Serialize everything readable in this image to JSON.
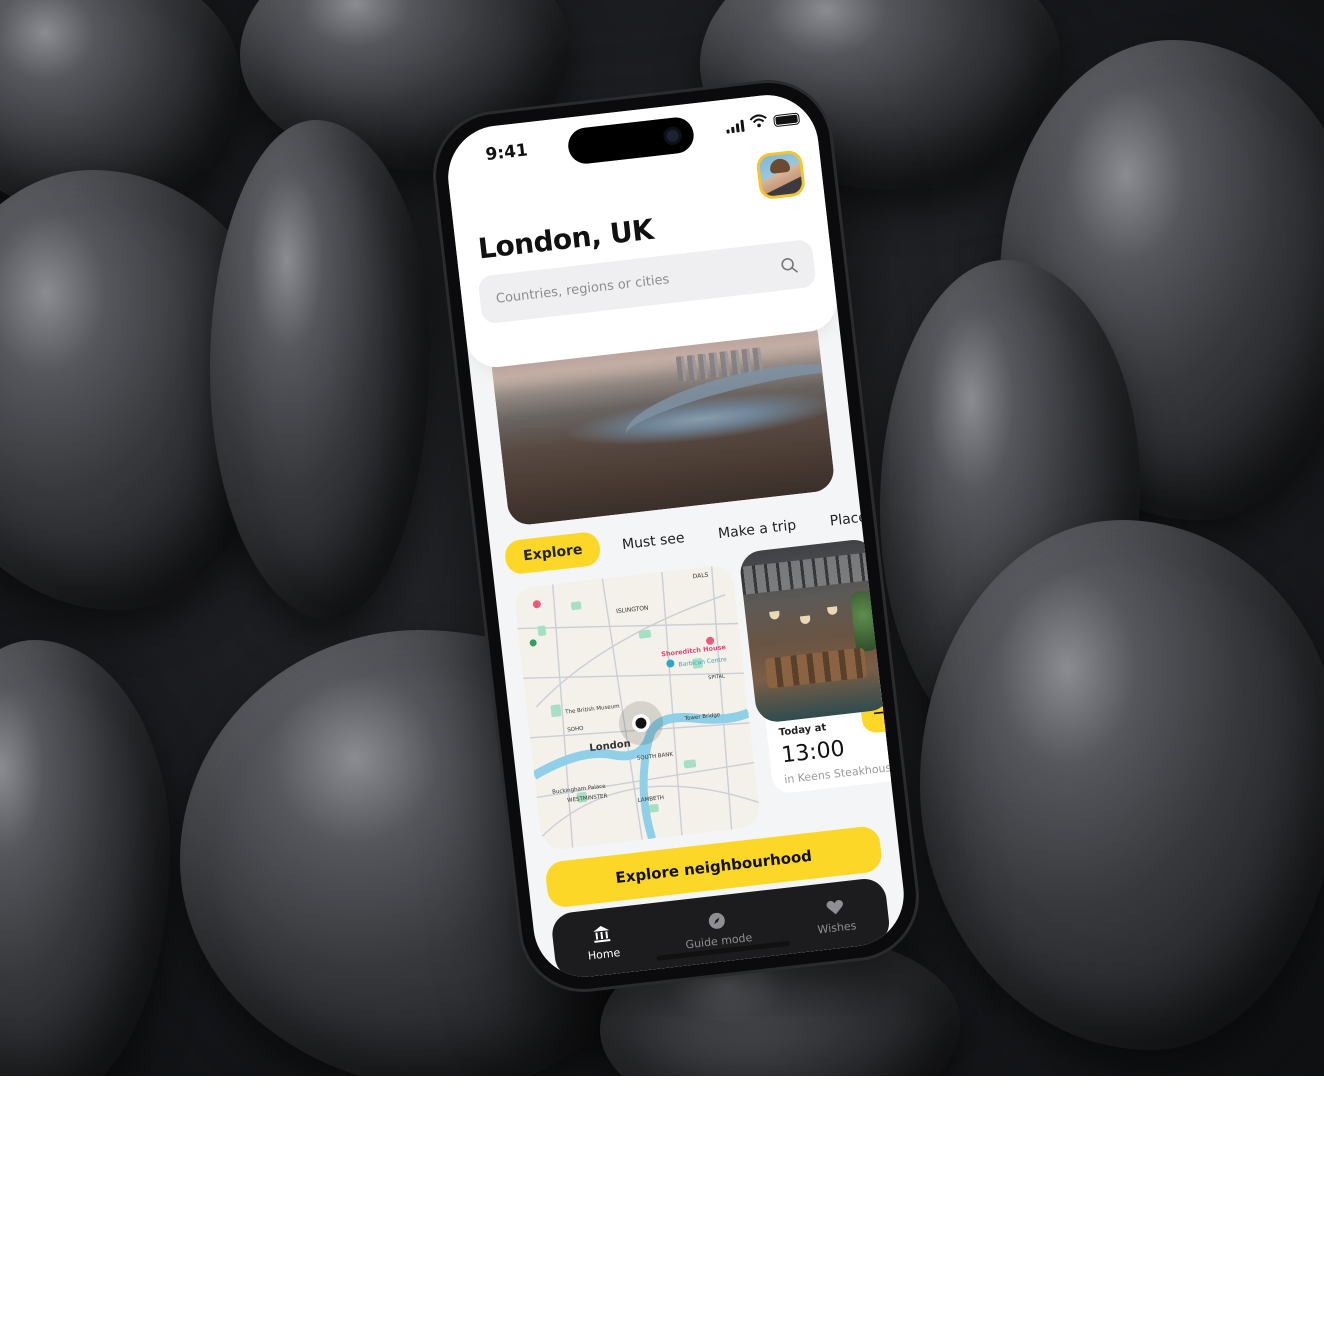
{
  "status": {
    "time": "9:41"
  },
  "header": {
    "title": "London, UK"
  },
  "search": {
    "placeholder": "Countries, regions or cities"
  },
  "tabs": [
    {
      "label": "Explore",
      "active": true
    },
    {
      "label": "Must see",
      "active": false
    },
    {
      "label": "Make a trip",
      "active": false
    },
    {
      "label": "Place to eat",
      "active": false
    }
  ],
  "map": {
    "labels": {
      "islington": "ISLINGTON",
      "shoreditch": "Shoreditch House",
      "barbican": "Barbican Centre",
      "museum": "The British Museum",
      "soho": "SOHO",
      "london": "London",
      "south_bank": "SOUTH BANK",
      "tower_bridge": "Tower Bridge",
      "spitalfields": "SPITAL",
      "buckingham": "Buckingham Palace",
      "westminster": "WESTMINSTER",
      "lambeth": "LAMBETH",
      "dals": "DALS"
    }
  },
  "venue": {
    "label": "Today at",
    "time": "13:00",
    "place": "in Keens Steakhouse",
    "arrow": "→"
  },
  "cta": {
    "label": "Explore neighbourhood"
  },
  "nav": {
    "home": "Home",
    "guide": "Guide mode",
    "wishes": "Wishes"
  },
  "colors": {
    "accent": "#fcd728",
    "nav_bg": "#1c1c1e",
    "screen_bg": "#f4f5f7"
  }
}
